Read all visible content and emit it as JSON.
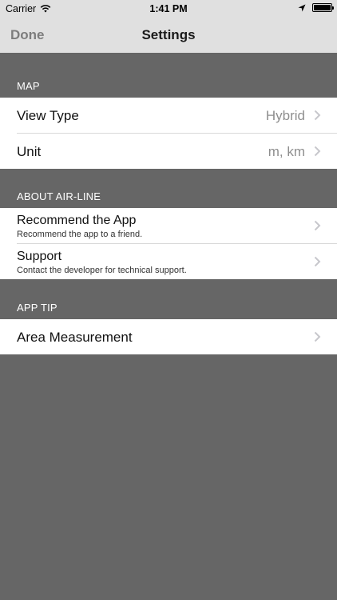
{
  "status_bar": {
    "carrier": "Carrier",
    "time": "1:41 PM",
    "icons": [
      "wifi-icon",
      "location-arrow-icon",
      "battery-icon"
    ]
  },
  "nav": {
    "done_label": "Done",
    "title": "Settings"
  },
  "sections": {
    "map": {
      "header": "MAP",
      "rows": {
        "view_type": {
          "label": "View Type",
          "value": "Hybrid"
        },
        "unit": {
          "label": "Unit",
          "value": "m, km"
        }
      }
    },
    "about": {
      "header": "ABOUT AIR-LINE",
      "rows": {
        "recommend": {
          "label": "Recommend the App",
          "subtitle": "Recommend the app to a friend."
        },
        "support": {
          "label": "Support",
          "subtitle": "Contact the developer for technical support."
        }
      }
    },
    "tip": {
      "header": "APP TIP",
      "rows": {
        "area": {
          "label": "Area Measurement"
        }
      }
    }
  },
  "colors": {
    "background": "#666666",
    "bar": "#e0e0e0",
    "cell": "#ffffff",
    "value_text": "#8e8e8e",
    "chevron": "#c7c7cc"
  }
}
